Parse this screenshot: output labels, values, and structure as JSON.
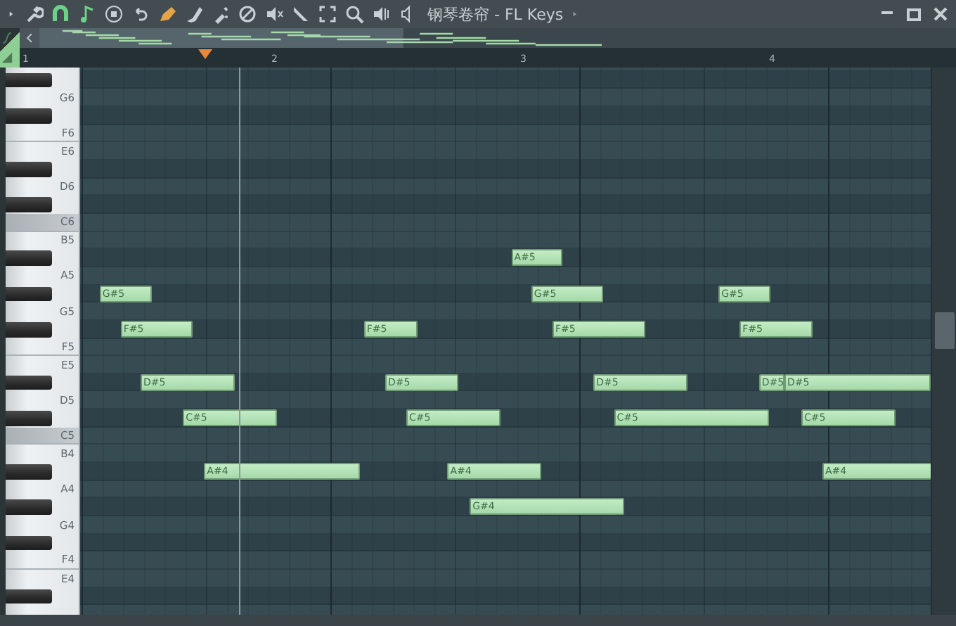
{
  "window": {
    "title": "钢琴卷帘 - FL Keys"
  },
  "ruler": {
    "bars": [
      "1",
      "2",
      "3",
      "4"
    ],
    "playhead": {
      "level": 0.186
    }
  },
  "rows": [
    {
      "black": false,
      "highlighted": false,
      "notes": []
    },
    {
      "black": true,
      "highlighted": false,
      "notes": []
    },
    {
      "black": false,
      "highlighted": false,
      "label": "G6",
      "notes": []
    },
    {
      "black": true,
      "highlighted": false,
      "notes": []
    },
    {
      "black": false,
      "highlighted": false,
      "label": "F6",
      "notes": []
    },
    {
      "black": false,
      "highlighted": false,
      "label": "E6",
      "notes": []
    },
    {
      "black": true,
      "highlighted": false,
      "notes": []
    },
    {
      "black": false,
      "highlighted": false,
      "label": "D6",
      "notes": []
    },
    {
      "black": true,
      "highlighted": false,
      "notes": []
    },
    {
      "black": false,
      "highlighted": true,
      "label": "C6",
      "notes": []
    },
    {
      "black": false,
      "highlighted": false,
      "label": "B5",
      "notes": []
    },
    {
      "black": true,
      "highlighted": false,
      "notes": [
        {
          "label": "A#5"
        }
      ]
    },
    {
      "black": false,
      "highlighted": false,
      "label": "A5",
      "notes": []
    },
    {
      "black": true,
      "highlighted": false,
      "notes": [
        {
          "label": "G#5"
        },
        {
          "label": "G#5"
        },
        {
          "label": "G#5"
        }
      ]
    },
    {
      "black": false,
      "highlighted": false,
      "label": "G5",
      "notes": []
    },
    {
      "black": true,
      "highlighted": false,
      "notes": [
        {
          "label": "F#5"
        },
        {
          "label": "F#5"
        },
        {
          "label": "F#5"
        },
        {
          "label": "F#5"
        }
      ]
    },
    {
      "black": false,
      "highlighted": false,
      "label": "F5",
      "notes": []
    },
    {
      "black": false,
      "highlighted": false,
      "label": "E5",
      "notes": []
    },
    {
      "black": true,
      "highlighted": false,
      "notes": [
        {
          "label": "D#5"
        },
        {
          "label": "D#5"
        },
        {
          "label": "D#5"
        },
        {
          "label": "D#5"
        },
        {
          "label": "D#5"
        }
      ]
    },
    {
      "black": false,
      "highlighted": false,
      "label": "D5",
      "notes": []
    },
    {
      "black": true,
      "highlighted": false,
      "notes": [
        {
          "label": "C#5"
        },
        {
          "label": "C#5"
        },
        {
          "label": "C#5"
        },
        {
          "label": "C#5"
        }
      ]
    },
    {
      "black": false,
      "highlighted": true,
      "label": "C5",
      "notes": []
    },
    {
      "black": false,
      "highlighted": false,
      "label": "B4",
      "notes": []
    },
    {
      "black": true,
      "highlighted": false,
      "notes": [
        {
          "label": "A#4"
        },
        {
          "label": "A#4"
        },
        {
          "label": "A#4"
        }
      ]
    },
    {
      "black": false,
      "highlighted": false,
      "label": "A4",
      "notes": []
    },
    {
      "black": true,
      "highlighted": false,
      "notes": [
        {
          "label": "G#4"
        }
      ]
    },
    {
      "black": false,
      "highlighted": false,
      "label": "G4",
      "notes": []
    },
    {
      "black": true,
      "highlighted": false,
      "notes": []
    },
    {
      "black": false,
      "highlighted": false,
      "label": "F4",
      "notes": []
    },
    {
      "black": false,
      "highlighted": false,
      "label": "E4",
      "notes": []
    },
    {
      "black": true,
      "highlighted": false,
      "notes": []
    },
    {
      "black": false,
      "highlighted": false,
      "notes": []
    }
  ]
}
